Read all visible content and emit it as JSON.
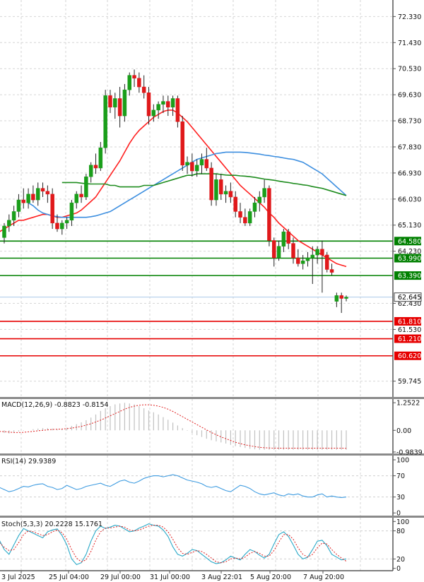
{
  "chart_data": {
    "type": "candlestick",
    "main": {
      "price_ticks": [
        "72.330",
        "71.430",
        "70.530",
        "69.630",
        "68.730",
        "67.830",
        "66.930",
        "66.030",
        "65.130",
        "64.230",
        "62.430",
        "61.530",
        "59.745"
      ],
      "x_labels": [
        "3 Jul 2025",
        "25 Jul 04:00",
        "29 Jul 00:00",
        "31 Jul 00:00",
        "3 Aug 22:01",
        "5 Aug 20:00",
        "7 Aug 20:00"
      ],
      "levels": [
        {
          "value": 64.58,
          "label": "64.580",
          "color": "#008000"
        },
        {
          "value": 63.99,
          "label": "63.990",
          "color": "#008000"
        },
        {
          "value": 63.39,
          "label": "63.390",
          "color": "#008000"
        },
        {
          "value": 61.81,
          "label": "61.810",
          "color": "#e60000"
        },
        {
          "value": 61.21,
          "label": "61.210",
          "color": "#e60000"
        },
        {
          "value": 60.62,
          "label": "60.620",
          "color": "#e60000"
        }
      ],
      "current_price": {
        "value": 62.645,
        "label": "62.645"
      },
      "candles": [
        {
          "o": 64.7,
          "h": 65.2,
          "l": 64.5,
          "c": 65.1
        },
        {
          "o": 65.1,
          "h": 65.5,
          "l": 64.9,
          "c": 65.3
        },
        {
          "o": 65.3,
          "h": 65.8,
          "l": 65.1,
          "c": 65.6
        },
        {
          "o": 65.6,
          "h": 66.2,
          "l": 65.4,
          "c": 66.0
        },
        {
          "o": 66.0,
          "h": 66.4,
          "l": 65.7,
          "c": 65.9
        },
        {
          "o": 65.9,
          "h": 66.4,
          "l": 65.7,
          "c": 66.2
        },
        {
          "o": 66.2,
          "h": 66.5,
          "l": 65.9,
          "c": 66.0
        },
        {
          "o": 66.0,
          "h": 66.6,
          "l": 65.8,
          "c": 66.4
        },
        {
          "o": 66.4,
          "h": 66.6,
          "l": 66.1,
          "c": 66.3
        },
        {
          "o": 66.3,
          "h": 66.5,
          "l": 65.9,
          "c": 66.2
        },
        {
          "o": 66.2,
          "h": 66.4,
          "l": 65.0,
          "c": 65.2
        },
        {
          "o": 65.2,
          "h": 65.5,
          "l": 64.9,
          "c": 65.0
        },
        {
          "o": 65.0,
          "h": 65.3,
          "l": 64.8,
          "c": 65.2
        },
        {
          "o": 65.2,
          "h": 65.4,
          "l": 65.0,
          "c": 65.3
        },
        {
          "o": 65.3,
          "h": 66.0,
          "l": 65.1,
          "c": 65.9
        },
        {
          "o": 65.9,
          "h": 66.3,
          "l": 65.7,
          "c": 66.2
        },
        {
          "o": 66.2,
          "h": 66.5,
          "l": 65.9,
          "c": 66.1
        },
        {
          "o": 66.1,
          "h": 66.9,
          "l": 66.0,
          "c": 66.8
        },
        {
          "o": 66.8,
          "h": 67.3,
          "l": 66.6,
          "c": 67.2
        },
        {
          "o": 67.2,
          "h": 67.6,
          "l": 66.9,
          "c": 67.1
        },
        {
          "o": 67.1,
          "h": 68.0,
          "l": 67.0,
          "c": 67.8
        },
        {
          "o": 67.8,
          "h": 69.8,
          "l": 67.6,
          "c": 69.6
        },
        {
          "o": 69.6,
          "h": 69.8,
          "l": 69.0,
          "c": 69.2
        },
        {
          "o": 69.2,
          "h": 69.7,
          "l": 68.8,
          "c": 69.5
        },
        {
          "o": 69.5,
          "h": 69.9,
          "l": 68.5,
          "c": 68.9
        },
        {
          "o": 68.9,
          "h": 70.0,
          "l": 68.7,
          "c": 69.8
        },
        {
          "o": 69.8,
          "h": 70.4,
          "l": 69.6,
          "c": 70.3
        },
        {
          "o": 70.3,
          "h": 70.5,
          "l": 69.9,
          "c": 70.2
        },
        {
          "o": 70.2,
          "h": 70.4,
          "l": 69.7,
          "c": 69.9
        },
        {
          "o": 69.9,
          "h": 70.3,
          "l": 69.5,
          "c": 69.7
        },
        {
          "o": 69.7,
          "h": 69.9,
          "l": 68.6,
          "c": 68.9
        },
        {
          "o": 68.9,
          "h": 69.3,
          "l": 68.7,
          "c": 69.1
        },
        {
          "o": 69.1,
          "h": 69.4,
          "l": 68.8,
          "c": 69.3
        },
        {
          "o": 69.3,
          "h": 69.6,
          "l": 69.0,
          "c": 69.4
        },
        {
          "o": 69.4,
          "h": 69.6,
          "l": 68.9,
          "c": 69.2
        },
        {
          "o": 69.2,
          "h": 69.6,
          "l": 68.9,
          "c": 69.5
        },
        {
          "o": 69.5,
          "h": 69.6,
          "l": 68.5,
          "c": 68.7
        },
        {
          "o": 68.7,
          "h": 68.9,
          "l": 67.0,
          "c": 67.2
        },
        {
          "o": 67.2,
          "h": 67.5,
          "l": 66.9,
          "c": 67.3
        },
        {
          "o": 67.3,
          "h": 67.6,
          "l": 66.8,
          "c": 67.0
        },
        {
          "o": 67.0,
          "h": 67.4,
          "l": 66.8,
          "c": 67.2
        },
        {
          "o": 67.2,
          "h": 67.6,
          "l": 66.9,
          "c": 67.4
        },
        {
          "o": 67.4,
          "h": 67.8,
          "l": 67.0,
          "c": 67.1
        },
        {
          "o": 67.1,
          "h": 67.3,
          "l": 65.8,
          "c": 66.0
        },
        {
          "o": 66.0,
          "h": 66.9,
          "l": 65.8,
          "c": 66.7
        },
        {
          "o": 66.7,
          "h": 66.9,
          "l": 66.0,
          "c": 66.2
        },
        {
          "o": 66.2,
          "h": 66.5,
          "l": 65.9,
          "c": 66.3
        },
        {
          "o": 66.3,
          "h": 66.6,
          "l": 65.9,
          "c": 66.1
        },
        {
          "o": 66.1,
          "h": 66.3,
          "l": 65.4,
          "c": 65.6
        },
        {
          "o": 65.6,
          "h": 65.9,
          "l": 65.2,
          "c": 65.4
        },
        {
          "o": 65.4,
          "h": 65.7,
          "l": 65.1,
          "c": 65.2
        },
        {
          "o": 65.2,
          "h": 65.7,
          "l": 65.1,
          "c": 65.6
        },
        {
          "o": 65.6,
          "h": 66.1,
          "l": 65.4,
          "c": 65.9
        },
        {
          "o": 65.9,
          "h": 66.3,
          "l": 65.6,
          "c": 66.1
        },
        {
          "o": 66.1,
          "h": 66.7,
          "l": 65.9,
          "c": 66.4
        },
        {
          "o": 66.4,
          "h": 66.5,
          "l": 64.4,
          "c": 64.6
        },
        {
          "o": 64.6,
          "h": 64.7,
          "l": 63.7,
          "c": 64.0
        },
        {
          "o": 64.0,
          "h": 64.6,
          "l": 63.9,
          "c": 64.4
        },
        {
          "o": 64.4,
          "h": 65.0,
          "l": 64.2,
          "c": 64.9
        },
        {
          "o": 64.9,
          "h": 65.0,
          "l": 64.3,
          "c": 64.5
        },
        {
          "o": 64.5,
          "h": 64.7,
          "l": 63.8,
          "c": 64.0
        },
        {
          "o": 64.0,
          "h": 64.3,
          "l": 63.7,
          "c": 63.8
        },
        {
          "o": 63.8,
          "h": 64.1,
          "l": 63.6,
          "c": 63.9
        },
        {
          "o": 63.9,
          "h": 64.2,
          "l": 63.7,
          "c": 64.0
        },
        {
          "o": 64.0,
          "h": 64.4,
          "l": 63.1,
          "c": 64.1
        },
        {
          "o": 64.1,
          "h": 64.4,
          "l": 63.8,
          "c": 64.3
        },
        {
          "o": 64.3,
          "h": 64.6,
          "l": 62.8,
          "c": 64.1
        },
        {
          "o": 64.1,
          "h": 64.2,
          "l": 63.5,
          "c": 63.6
        },
        {
          "o": 63.6,
          "h": 63.8,
          "l": 63.4,
          "c": 63.5
        },
        {
          "o": 62.5,
          "h": 62.8,
          "l": 62.3,
          "c": 62.7
        },
        {
          "o": 62.7,
          "h": 62.8,
          "l": 62.1,
          "c": 62.6
        },
        {
          "o": 62.6,
          "h": 62.7,
          "l": 62.5,
          "c": 62.645
        }
      ],
      "moving_averages": [
        {
          "color": "#ff2020",
          "values": [
            64.9,
            65.0,
            65.1,
            65.2,
            65.3,
            65.3,
            65.35,
            65.4,
            65.45,
            65.5,
            65.5,
            65.45,
            65.4,
            65.4,
            65.45,
            65.5,
            65.55,
            65.65,
            65.8,
            65.95,
            66.1,
            66.35,
            66.6,
            66.85,
            67.1,
            67.35,
            67.65,
            67.95,
            68.2,
            68.4,
            68.55,
            68.7,
            68.85,
            68.95,
            69.05,
            69.1,
            69.1,
            69.0,
            68.85,
            68.7,
            68.5,
            68.3,
            68.1,
            67.9,
            67.7,
            67.5,
            67.3,
            67.1,
            66.9,
            66.7,
            66.5,
            66.35,
            66.2,
            66.05,
            65.9,
            65.75,
            65.55,
            65.4,
            65.2,
            65.05,
            64.9,
            64.75,
            64.6,
            64.5,
            64.4,
            64.3,
            64.2,
            64.1,
            64.0,
            63.9,
            63.8,
            63.75,
            63.7
          ]
        },
        {
          "color": "#3d8fe0",
          "values": [
            65.9,
            65.8,
            65.65,
            65.55,
            65.5,
            65.45,
            65.42,
            65.4,
            65.4,
            65.4,
            65.4,
            65.4,
            65.4,
            65.42,
            65.45,
            65.5,
            65.55,
            65.6,
            65.7,
            65.8,
            65.9,
            66.0,
            66.1,
            66.2,
            66.3,
            66.4,
            66.5,
            66.6,
            66.7,
            66.8,
            66.9,
            67.0,
            67.1,
            67.2,
            67.3,
            67.4,
            67.45,
            67.5,
            67.55,
            67.6,
            67.62,
            67.65,
            67.65,
            67.65,
            67.65,
            67.64,
            67.62,
            67.6,
            67.58,
            67.55,
            67.53,
            67.5,
            67.48,
            67.45,
            67.42,
            67.4,
            67.35,
            67.3,
            67.2,
            67.1,
            67.0,
            66.9,
            66.75,
            66.6,
            66.45,
            66.3,
            66.15
          ]
        },
        {
          "color": "#1e8c1e",
          "values": [
            66.6,
            66.6,
            66.6,
            66.6,
            66.58,
            66.56,
            66.55,
            66.55,
            66.55,
            66.55,
            66.5,
            66.5,
            66.45,
            66.45,
            66.45,
            66.45,
            66.45,
            66.5,
            66.5,
            66.5,
            66.55,
            66.6,
            66.65,
            66.7,
            66.75,
            66.8,
            66.85,
            66.85,
            66.9,
            66.9,
            66.9,
            66.9,
            66.9,
            66.88,
            66.86,
            66.85,
            66.85,
            66.83,
            66.82,
            66.8,
            66.78,
            66.75,
            66.72,
            66.7,
            66.68,
            66.65,
            66.62,
            66.6,
            66.57,
            66.55,
            66.52,
            66.5,
            66.46,
            66.43,
            66.4,
            66.35,
            66.3,
            66.25,
            66.2,
            66.15
          ]
        }
      ]
    },
    "macd": {
      "label": "MACD(12,26,9) -0.8823 -0.8154",
      "ticks": [
        "1.2522",
        "0.00",
        "-0.9839"
      ],
      "histogram": [
        -0.1,
        -0.12,
        -0.14,
        -0.1,
        -0.05,
        -0.02,
        0.0,
        0.05,
        0.08,
        0.1,
        0.1,
        0.08,
        0.05,
        0.06,
        0.12,
        0.2,
        0.28,
        0.36,
        0.46,
        0.58,
        0.72,
        0.88,
        1.0,
        1.1,
        1.18,
        1.22,
        1.25,
        1.22,
        1.18,
        1.1,
        1.0,
        0.9,
        0.82,
        0.72,
        0.6,
        0.48,
        0.35,
        0.22,
        0.1,
        -0.02,
        -0.12,
        -0.22,
        -0.3,
        -0.38,
        -0.45,
        -0.5,
        -0.55,
        -0.6,
        -0.66,
        -0.72,
        -0.76,
        -0.8,
        -0.84,
        -0.86,
        -0.88,
        -0.88,
        -0.88,
        -0.88,
        -0.88,
        -0.88,
        -0.88,
        -0.88,
        -0.88,
        -0.88,
        -0.88,
        -0.88,
        -0.88,
        -0.88,
        -0.88,
        -0.88,
        -0.88,
        -0.88,
        -0.8823
      ],
      "signal": [
        -0.05,
        -0.06,
        -0.08,
        -0.1,
        -0.1,
        -0.09,
        -0.07,
        -0.05,
        -0.02,
        0.0,
        0.02,
        0.04,
        0.05,
        0.06,
        0.08,
        0.1,
        0.14,
        0.18,
        0.24,
        0.3,
        0.38,
        0.46,
        0.56,
        0.66,
        0.76,
        0.86,
        0.96,
        1.04,
        1.1,
        1.14,
        1.16,
        1.16,
        1.14,
        1.1,
        1.04,
        0.96,
        0.86,
        0.74,
        0.62,
        0.5,
        0.38,
        0.26,
        0.14,
        0.02,
        -0.1,
        -0.2,
        -0.3,
        -0.38,
        -0.46,
        -0.54,
        -0.6,
        -0.66,
        -0.7,
        -0.74,
        -0.77,
        -0.79,
        -0.8,
        -0.81,
        -0.81,
        -0.81,
        -0.81,
        -0.81,
        -0.81,
        -0.81,
        -0.81,
        -0.81,
        -0.81,
        -0.81,
        -0.81,
        -0.81,
        -0.81,
        -0.81,
        -0.8154
      ]
    },
    "rsi": {
      "label": "RSI(14) 29.9389",
      "ticks": [
        "100",
        "70",
        "30",
        "0"
      ],
      "values": [
        48,
        44,
        40,
        42,
        46,
        50,
        49,
        52,
        54,
        55,
        50,
        48,
        44,
        46,
        52,
        48,
        44,
        46,
        50,
        52,
        54,
        56,
        52,
        50,
        55,
        60,
        62,
        58,
        56,
        60,
        65,
        68,
        70,
        70,
        68,
        70,
        72,
        70,
        66,
        62,
        60,
        58,
        55,
        50,
        48,
        50,
        46,
        42,
        40,
        46,
        52,
        50,
        46,
        40,
        36,
        34,
        36,
        38,
        34,
        32,
        36,
        34,
        36,
        32,
        30,
        30,
        34,
        36,
        30,
        32,
        30,
        29,
        29.9389
      ]
    },
    "stoch": {
      "label": "Stoch(5,3,3) 20.2228 15.1761",
      "ticks": [
        "100",
        "80",
        "20",
        "0"
      ],
      "k": [
        60,
        40,
        30,
        50,
        70,
        85,
        80,
        75,
        70,
        65,
        78,
        82,
        84,
        70,
        50,
        20,
        8,
        12,
        30,
        58,
        80,
        90,
        85,
        88,
        92,
        90,
        84,
        78,
        80,
        86,
        90,
        95,
        92,
        90,
        82,
        68,
        46,
        30,
        26,
        32,
        40,
        38,
        30,
        22,
        14,
        10,
        12,
        18,
        26,
        22,
        18,
        30,
        40,
        36,
        28,
        22,
        30,
        52,
        72,
        78,
        68,
        50,
        30,
        20,
        24,
        40,
        58,
        60,
        48,
        30,
        24,
        18,
        20.2228
      ],
      "d": [
        55,
        45,
        38,
        40,
        55,
        72,
        80,
        78,
        74,
        70,
        72,
        78,
        82,
        76,
        62,
        40,
        22,
        14,
        18,
        36,
        60,
        78,
        86,
        86,
        88,
        90,
        88,
        82,
        80,
        82,
        86,
        90,
        92,
        92,
        88,
        78,
        62,
        44,
        32,
        30,
        34,
        38,
        36,
        30,
        22,
        14,
        12,
        14,
        20,
        22,
        20,
        24,
        32,
        36,
        32,
        26,
        26,
        38,
        56,
        72,
        72,
        62,
        44,
        30,
        24,
        30,
        44,
        54,
        52,
        40,
        30,
        22,
        15.1761
      ]
    }
  }
}
